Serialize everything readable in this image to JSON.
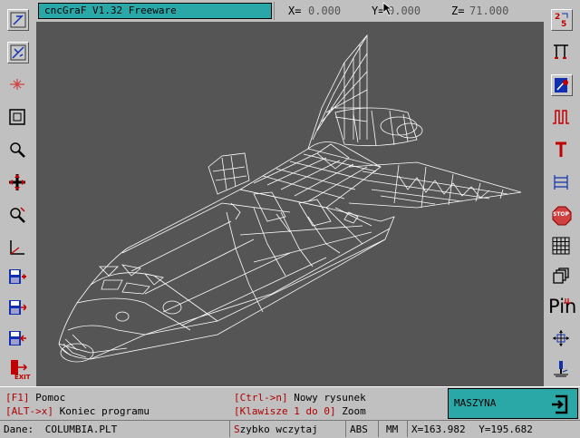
{
  "title_bar": {
    "title": "cncGraF V1.32 Freeware"
  },
  "coordinates": {
    "x_label": "X=",
    "x_value": "0.000",
    "y_label": "Y=",
    "y_value": "0.000",
    "z_label": "Z=",
    "z_value": "71.000"
  },
  "left_toolbar": [
    "snap-icon",
    "snap-alt-icon",
    "break-icon",
    "frame-icon",
    "zoom-icon",
    "move-icon",
    "zoom-area-icon",
    "axes-icon",
    "save-add-icon",
    "save-next-icon",
    "save-prev-icon",
    "exit-icon"
  ],
  "exit_label": "EXIT",
  "right_toolbar": [
    "rotate-25-icon",
    "tool-height-icon",
    "measure-icon",
    "pulse-icon",
    "tool-icon",
    "list-icon",
    "stop-icon",
    "grid-icon",
    "layers-icon",
    "pin-icon",
    "scale-icon",
    "cutter-icon"
  ],
  "stop_label": "STOP",
  "pin_label": "Pin",
  "hotkeys": {
    "f1_key": "[F1]",
    "f1_label": " Pomoc",
    "alt_key": "[ALT->x]",
    "alt_label": " Koniec programu",
    "ctrl_key": "[Ctrl->n]",
    "ctrl_label": " Nowy rysunek",
    "num_key": "[Klawisze 1 do 0]",
    "num_label": " Zoom"
  },
  "machine_button": {
    "label": "MASZYNA"
  },
  "status_bar": {
    "file_label": "Dane:",
    "file_name": "COLUMBIA.PLT",
    "quick_load_hot": "S",
    "quick_load_rest": "zybko wczytaj",
    "abs": "ABS",
    "mm": "MM",
    "x_label": "X=",
    "x_value": "163.982",
    "y_label": "Y=",
    "y_value": "195.682"
  },
  "colors": {
    "accent": "#2aa8a8",
    "canvas": "#555555",
    "panel": "#c0c0c0",
    "hotkey": "#b00000",
    "icon_blue": "#1030b0",
    "icon_red": "#c00000",
    "wireframe": "#ffffff"
  }
}
